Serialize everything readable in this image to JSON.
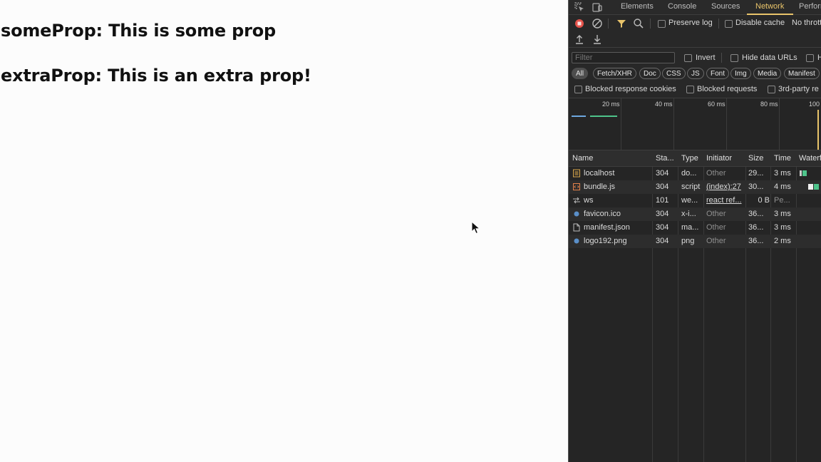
{
  "page": {
    "line1": "someProp: This is some prop",
    "line2": "extraProp: This is an extra prop!"
  },
  "devtools": {
    "tabs": [
      "Elements",
      "Console",
      "Sources",
      "Network",
      "Perform"
    ],
    "active_tab": "Network",
    "toolbar": {
      "preserve_log": "Preserve log",
      "disable_cache": "Disable cache",
      "throttling": "No thrott"
    },
    "filter": {
      "placeholder": "Filter",
      "invert": "Invert",
      "hide_data_urls": "Hide data URLs",
      "hide_ext": "H"
    },
    "type_chips": [
      "All",
      "Fetch/XHR",
      "Doc",
      "CSS",
      "JS",
      "Font",
      "Img",
      "Media",
      "Manifest"
    ],
    "options": {
      "blocked_cookies": "Blocked response cookies",
      "blocked_requests": "Blocked requests",
      "third_party": "3rd-party re"
    },
    "overview_ticks": [
      "20 ms",
      "40 ms",
      "60 ms",
      "80 ms",
      "100"
    ],
    "columns": [
      "Name",
      "Sta...",
      "Type",
      "Initiator",
      "Size",
      "Time",
      "Waterf"
    ],
    "rows": [
      {
        "icon": "document-icon",
        "name": "localhost",
        "status": "304",
        "type": "do...",
        "initiator": "Other",
        "size": "29...",
        "time": "3 ms"
      },
      {
        "icon": "script-icon",
        "name": "bundle.js",
        "status": "304",
        "type": "script",
        "initiator": "(index):27",
        "size": "30...",
        "time": "4 ms"
      },
      {
        "icon": "websocket-icon",
        "name": "ws",
        "status": "101",
        "type": "we...",
        "initiator": "react ref...",
        "size": "0 B",
        "time": "Pe..."
      },
      {
        "icon": "image-icon",
        "name": "favicon.ico",
        "status": "304",
        "type": "x-i...",
        "initiator": "Other",
        "size": "36...",
        "time": "3 ms"
      },
      {
        "icon": "file-icon",
        "name": "manifest.json",
        "status": "304",
        "type": "ma...",
        "initiator": "Other",
        "size": "36...",
        "time": "3 ms"
      },
      {
        "icon": "image-icon",
        "name": "logo192.png",
        "status": "304",
        "type": "png",
        "initiator": "Other",
        "size": "36...",
        "time": "2 ms"
      }
    ],
    "colors": {
      "accent": "#e9c46a",
      "record_red": "#e5534b",
      "waterfall_green": "#4ec48b",
      "waterfall_blue": "#6ea8e0"
    }
  }
}
